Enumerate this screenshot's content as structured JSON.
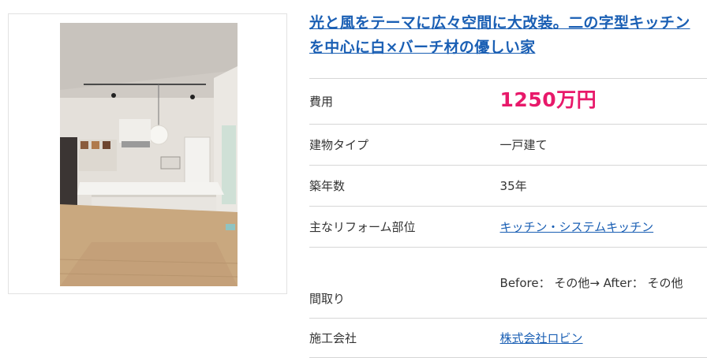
{
  "title": "光と風をテーマに広々空間に大改装。二の字型キッチンを中心に白×バーチ材の優しい家",
  "photo_icon": "kitchen-photo",
  "colors": {
    "link": "#1a5fb4",
    "price": "#e8196a",
    "divider": "#d6d6d6"
  },
  "rows": {
    "cost": {
      "label": "費用",
      "value": "1250万円"
    },
    "building_type": {
      "label": "建物タイプ",
      "value": "一戸建て"
    },
    "age": {
      "label": "築年数",
      "value": "35年"
    },
    "parts": {
      "label": "主なリフォーム部位",
      "value": "キッチン・システムキッチン"
    },
    "layout": {
      "label": "間取り",
      "value": "Before： その他→ After： その他"
    },
    "company": {
      "label": "施工会社",
      "value": "株式会社ロビン"
    }
  }
}
